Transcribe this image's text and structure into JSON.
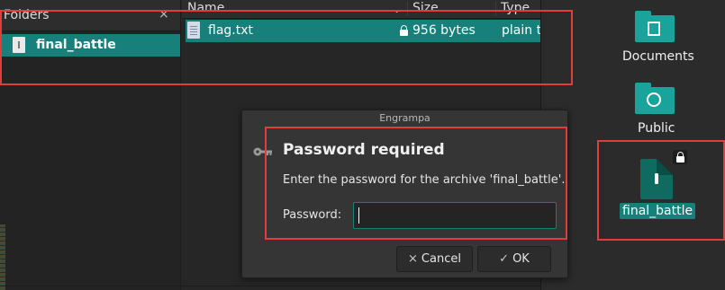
{
  "folders_panel": {
    "title": "Folders",
    "close_glyph": "×",
    "items": [
      {
        "label": "final_battle",
        "icon": "archive-icon"
      }
    ]
  },
  "file_list": {
    "columns": {
      "name": "Name",
      "sort_indicator": "⌄",
      "size": "Size",
      "type": "Type"
    },
    "rows": [
      {
        "name": "flag.txt",
        "locked": true,
        "size": "956 bytes",
        "type": "plain text"
      }
    ]
  },
  "desktop": {
    "icons": [
      {
        "label": "Documents",
        "icon": "documents-folder-icon"
      },
      {
        "label": "Public",
        "icon": "public-folder-icon"
      },
      {
        "label": "final_battle",
        "icon": "archive-icon",
        "locked": true
      }
    ]
  },
  "dialog": {
    "window_title": "Engrampa",
    "heading": "Password required",
    "message": "Enter the password for the archive 'final_battle'.",
    "password_label": "Password:",
    "password_value": "",
    "cancel_label": "Cancel",
    "cancel_glyph": "×",
    "ok_label": "OK",
    "ok_glyph": "✓"
  },
  "colors": {
    "accent": "#17807a",
    "highlight": "#e23c3c",
    "dialog_bg": "#353535",
    "desktop_bg": "#2b2b2b"
  }
}
